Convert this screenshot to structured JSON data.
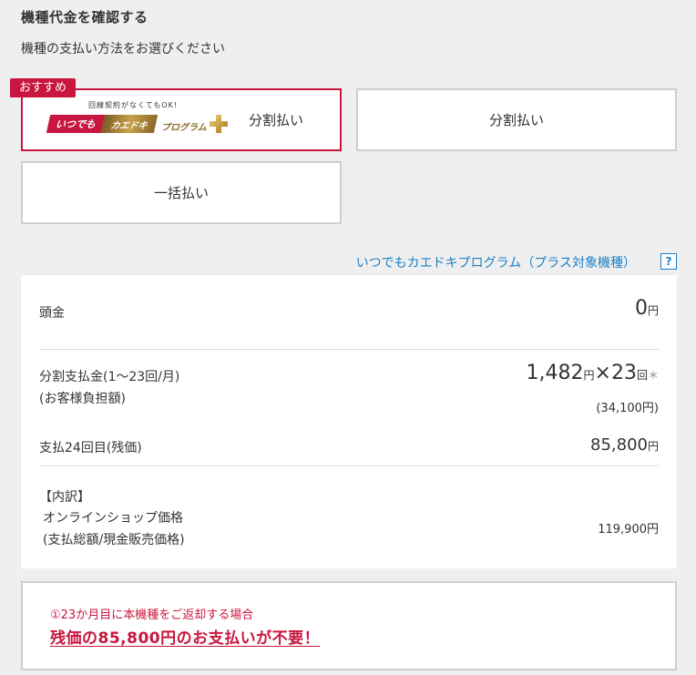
{
  "header": {
    "title": "機種代金を確認する",
    "subtitle": "機種の支払い方法をお選びください"
  },
  "options": {
    "badge": "おすすめ",
    "kaedoki": {
      "logo_small": "回線契約がなくてもOK!",
      "logo_red": "いつでも",
      "logo_gold": "カエドキ",
      "logo_prog": "プログラム",
      "label": "分割払い"
    },
    "split": {
      "label": "分割払い"
    },
    "lump": {
      "label": "一括払い"
    }
  },
  "help": {
    "link_text": "いつでもカエドキプログラム（プラス対象機種）",
    "icon": "?"
  },
  "breakdown": {
    "down_payment": {
      "label": "頭金",
      "amount": "0",
      "unit": "円"
    },
    "installment": {
      "label1": "分割支払金(1～23回/月)",
      "label2": "(お客様負担額)",
      "amount": "1,482",
      "unit": "円",
      "times_sign": "×",
      "count": "23",
      "count_unit": "回",
      "asterisk": "＊",
      "total_note": "(34,100円)"
    },
    "residual": {
      "label": "支払24回目(残価)",
      "amount": "85,800",
      "unit": "円"
    },
    "detail": {
      "header": "【内訳】",
      "label1": "オンラインショップ価格",
      "label2": "(支払総額/現金販売価格)",
      "amount": "119,900円"
    }
  },
  "promo": {
    "line1": "①23か月目に本機種をご返却する場合",
    "line2": "残価の85,800円のお支払いが不要！"
  },
  "colors": {
    "accent": "#c9163e",
    "link": "#1d7fc7",
    "background": "#efefef"
  }
}
